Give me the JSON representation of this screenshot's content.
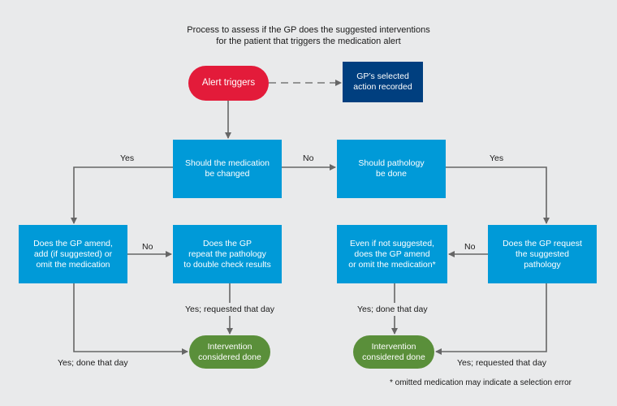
{
  "title": {
    "line1": "Process to assess if the GP does the suggested interventions",
    "line2": "for the patient that triggers the medication alert"
  },
  "nodes": {
    "alert": {
      "lines": [
        "Alert triggers"
      ],
      "color": "#e31b3a"
    },
    "recorded": {
      "lines": [
        "GP’s selected",
        "action recorded"
      ],
      "color": "#003f7f"
    },
    "med_change": {
      "lines": [
        "Should the medication",
        "be changed"
      ],
      "color": "#009ad8"
    },
    "pathology": {
      "lines": [
        "Should pathology",
        "be done"
      ],
      "color": "#009ad8"
    },
    "amend": {
      "lines": [
        "Does the GP amend,",
        "add (if suggested) or",
        "omit the medication"
      ],
      "color": "#009ad8"
    },
    "repeat": {
      "lines": [
        "Does the GP",
        "repeat the pathology",
        "to double check results"
      ],
      "color": "#009ad8"
    },
    "even_if": {
      "lines": [
        "Even if not suggested,",
        "does the GP  amend",
        "or omit the medication*"
      ],
      "color": "#009ad8"
    },
    "request": {
      "lines": [
        "Does the GP request",
        "the suggested",
        "pathology"
      ],
      "color": "#009ad8"
    },
    "done_left": {
      "lines": [
        "Intervention",
        "considered done"
      ],
      "color": "#5a8f3a"
    },
    "done_right": {
      "lines": [
        "Intervention",
        "considered done"
      ],
      "color": "#5a8f3a"
    }
  },
  "edge_labels": {
    "med_yes": "Yes",
    "med_no": "No",
    "path_yes": "Yes",
    "amend_no": "No",
    "request_no": "No",
    "repeat_yes": "Yes; requested that day",
    "amend_yes": "Yes; done that day",
    "even_yes": "Yes; done that day",
    "request_yes": "Yes; requested that day"
  },
  "footnote": "* omitted medication may indicate a selection error",
  "colors": {
    "background": "#e9eaeb",
    "connector": "#666666"
  }
}
